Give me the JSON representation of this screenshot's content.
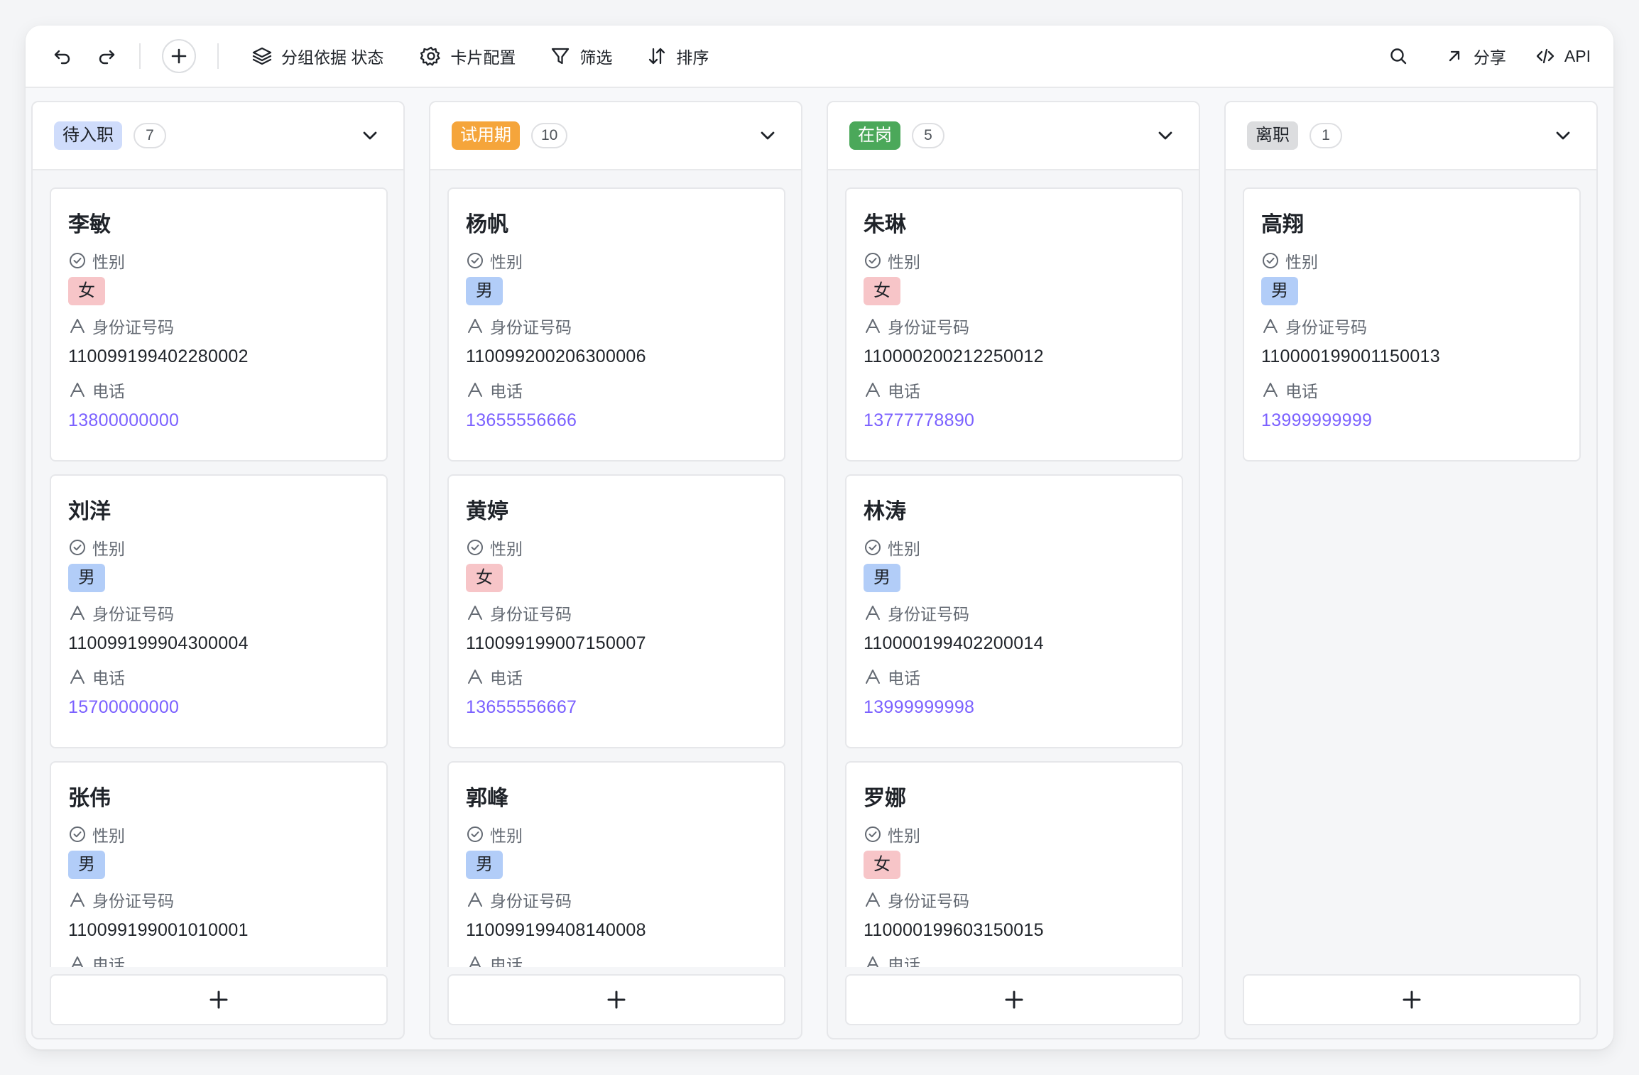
{
  "toolbar": {
    "group_by_label": "分组依据 状态",
    "card_config_label": "卡片配置",
    "filter_label": "筛选",
    "sort_label": "排序",
    "share_label": "分享",
    "api_label": "API"
  },
  "field_labels": {
    "gender": "性别",
    "id_number": "身份证号码",
    "phone": "电话"
  },
  "colors": {
    "status_pending": "#cfdcfb",
    "status_probation": "#f5a53b",
    "status_active": "#4ba85a",
    "status_resigned": "#dcdddf",
    "gender_female": "#f7c5c8",
    "gender_male": "#b2cdf8",
    "phone_link": "#7b61ff"
  },
  "columns": [
    {
      "status": "待入职",
      "count": "7",
      "cards": [
        {
          "name": "李敏",
          "gender": "女",
          "id_number": "110099199402280002",
          "phone": "13800000000"
        },
        {
          "name": "刘洋",
          "gender": "男",
          "id_number": "110099199904300004",
          "phone": "15700000000"
        },
        {
          "name": "张伟",
          "gender": "男",
          "id_number": "110099199001010001",
          "phone": ""
        }
      ]
    },
    {
      "status": "试用期",
      "count": "10",
      "cards": [
        {
          "name": "杨帆",
          "gender": "男",
          "id_number": "110099200206300006",
          "phone": "13655556666"
        },
        {
          "name": "黄婷",
          "gender": "女",
          "id_number": "110099199007150007",
          "phone": "13655556667"
        },
        {
          "name": "郭峰",
          "gender": "男",
          "id_number": "110099199408140008",
          "phone": ""
        }
      ]
    },
    {
      "status": "在岗",
      "count": "5",
      "cards": [
        {
          "name": "朱琳",
          "gender": "女",
          "id_number": "110000200212250012",
          "phone": "13777778890"
        },
        {
          "name": "林涛",
          "gender": "男",
          "id_number": "110000199402200014",
          "phone": "13999999998"
        },
        {
          "name": "罗娜",
          "gender": "女",
          "id_number": "110000199603150015",
          "phone": ""
        }
      ]
    },
    {
      "status": "离职",
      "count": "1",
      "cards": [
        {
          "name": "高翔",
          "gender": "男",
          "id_number": "110000199001150013",
          "phone": "13999999999"
        }
      ]
    }
  ]
}
